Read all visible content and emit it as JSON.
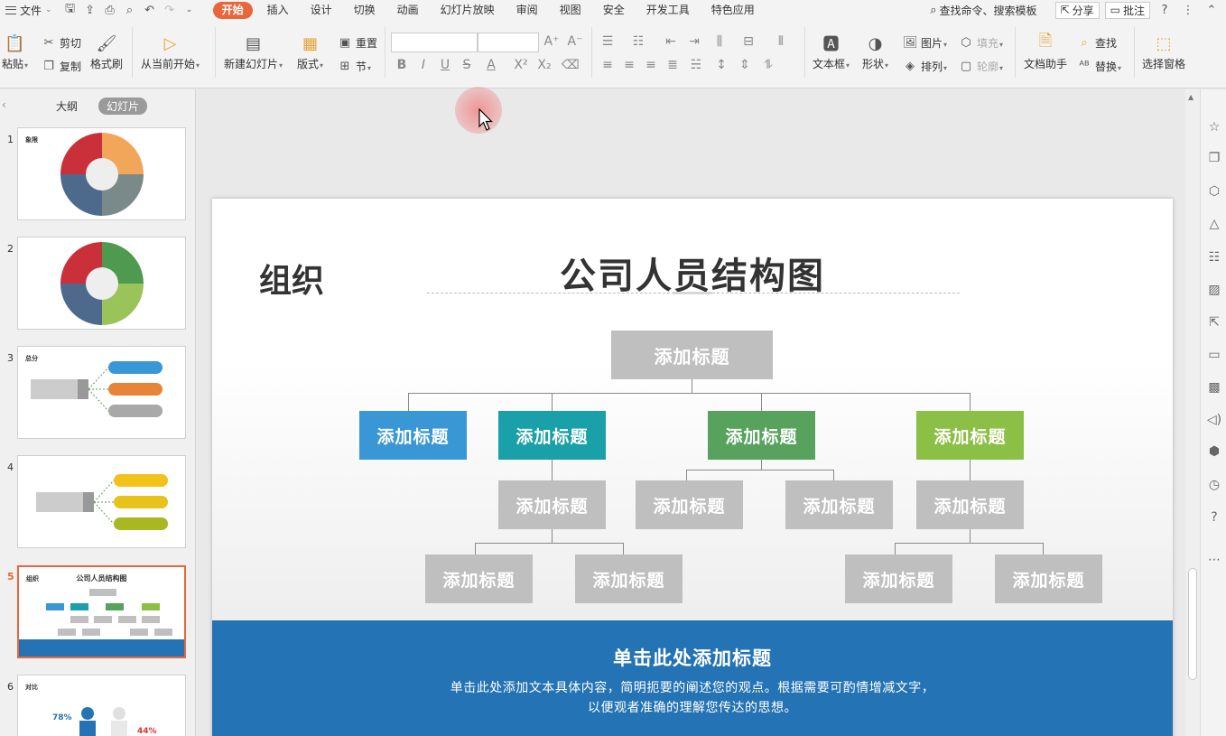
{
  "menubar": {
    "file": "文件",
    "tabs": [
      "开始",
      "插入",
      "设计",
      "切换",
      "动画",
      "幻灯片放映",
      "审阅",
      "视图",
      "安全",
      "开发工具",
      "特色应用"
    ],
    "active_tab": "开始",
    "search": "查找命令、搜索模板",
    "share": "分享",
    "comment": "批注"
  },
  "ribbon": {
    "paste": "粘贴",
    "cut": "剪切",
    "copy": "复制",
    "format_painter": "格式刷",
    "from_current": "从当前开始",
    "new_slide": "新建幻灯片",
    "layout": "版式",
    "reset": "重置",
    "section": "节",
    "text_box": "文本框",
    "shape": "形状",
    "picture": "图片",
    "fill": "填充",
    "arrange": "排列",
    "outline": "轮廓",
    "doc_assistant": "文档助手",
    "find": "查找",
    "replace": "替换",
    "select_pane": "选择窗格"
  },
  "left_panel": {
    "tab_outline": "大纲",
    "tab_slides": "幻灯片",
    "slides": [
      {
        "num": "1",
        "label": "象限"
      },
      {
        "num": "2",
        "label": ""
      },
      {
        "num": "3",
        "label": "总分"
      },
      {
        "num": "4",
        "label": ""
      },
      {
        "num": "5",
        "label": "组织",
        "title": "公司人员结构图"
      },
      {
        "num": "6",
        "label": "对比",
        "stat1": "78%",
        "stat2": "44%"
      }
    ],
    "selected": "5"
  },
  "slide": {
    "label": "组织",
    "title": "公司人员结构图",
    "root": "添加标题",
    "level1": [
      "添加标题",
      "添加标题",
      "添加标题",
      "添加标题"
    ],
    "level2": [
      "添加标题",
      "添加标题",
      "添加标题",
      "添加标题"
    ],
    "level3": [
      "添加标题",
      "添加标题",
      "添加标题",
      "添加标题"
    ],
    "footer_title": "单击此处添加标题",
    "footer_line1": "单击此处添加文本具体内容，简明扼要的阐述您的观点。根据需要可酌情增减文字，",
    "footer_line2": "以便观者准确的理解您传达的思想。"
  },
  "colors": {
    "accent": "#e8663a",
    "blue": "#3a97d6",
    "teal": "#1aa0a8",
    "green": "#57a35d",
    "lime": "#8cbf45",
    "grey_node": "#bfbfbf",
    "footer": "#2473b4"
  }
}
